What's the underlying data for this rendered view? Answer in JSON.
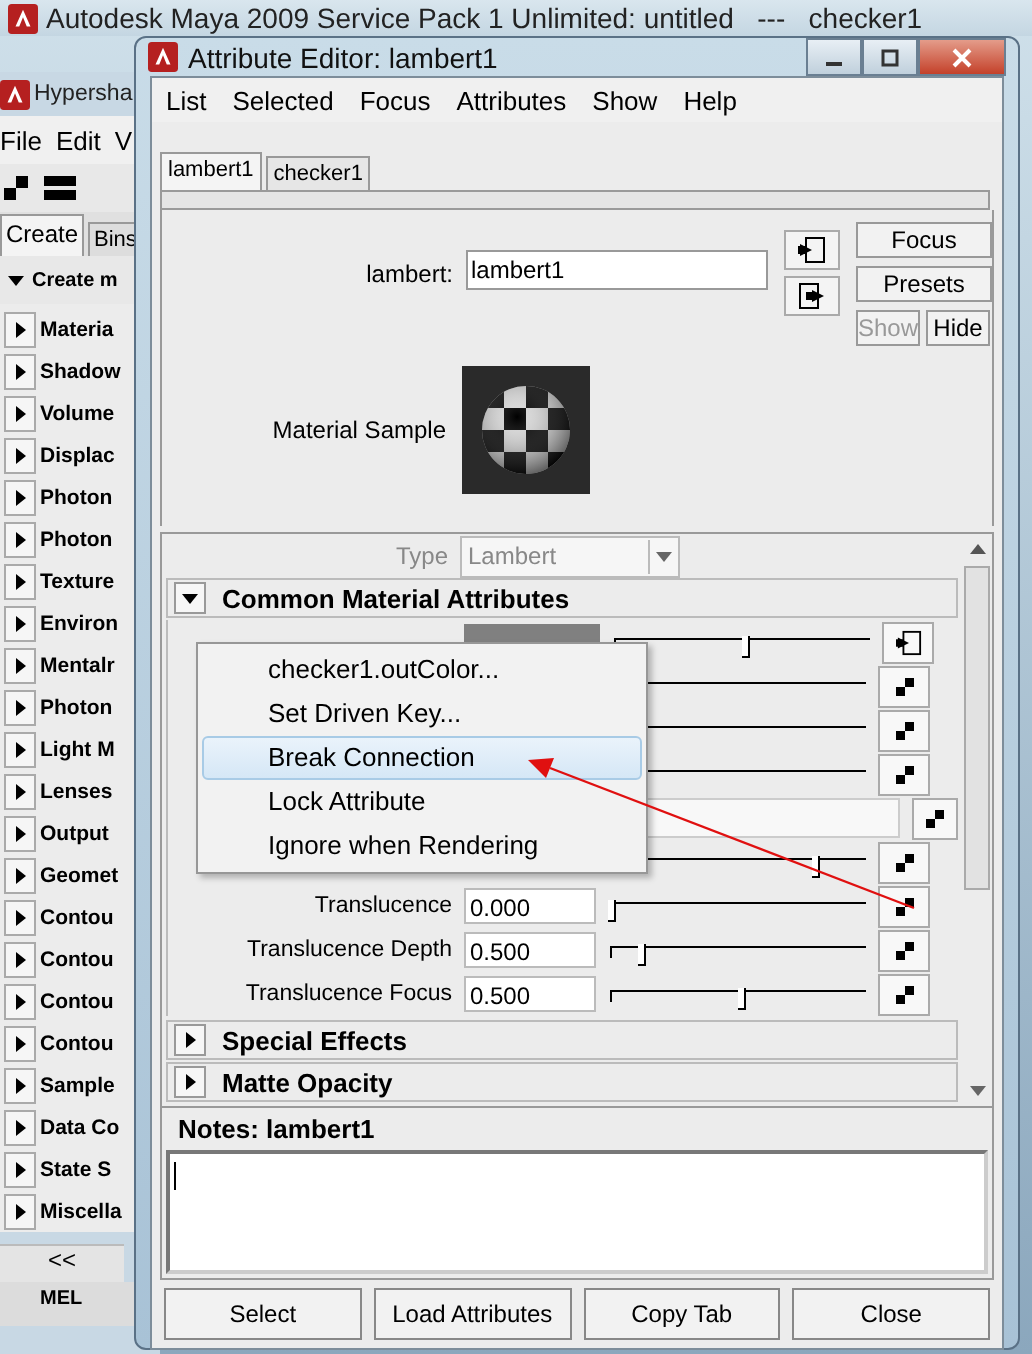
{
  "main_window": {
    "title": "Autodesk Maya 2009 Service Pack 1 Unlimited: untitled   ---   checker1"
  },
  "hypershade": {
    "title": "Hypersha",
    "menu": [
      "File",
      "Edit",
      "V"
    ],
    "tabs": [
      {
        "label": "Create",
        "selected": true
      },
      {
        "label": "Bins",
        "selected": false
      }
    ],
    "section": "Create m",
    "items": [
      "Materia",
      "Shadow",
      "Volume",
      "Displac",
      "Photon",
      "Photon",
      "Texture",
      "Environ",
      "Mentalr",
      "Photon",
      "Light M",
      "Lenses",
      "Output",
      "Geomet",
      "Contou",
      "Contou",
      "Contou",
      "Contou",
      "Sample",
      "Data Co",
      "State S",
      "Miscella"
    ],
    "collapse": "<<",
    "bottom_tab": "MEL"
  },
  "attribute_editor": {
    "title": "Attribute Editor: lambert1",
    "menu": [
      "List",
      "Selected",
      "Focus",
      "Attributes",
      "Show",
      "Help"
    ],
    "tabs": [
      {
        "label": "lambert1",
        "selected": true
      },
      {
        "label": "checker1",
        "selected": false
      }
    ],
    "name_label": "lambert:",
    "name_value": "lambert1",
    "buttons": [
      {
        "label": "Focus",
        "disabled": false
      },
      {
        "label": "Presets",
        "disabled": false
      },
      {
        "label": "Show",
        "disabled": true
      },
      {
        "label": "Hide",
        "disabled": false
      }
    ],
    "sample_label": "Material Sample",
    "type_label": "Type",
    "type_value": "Lambert",
    "sections": [
      {
        "title": "Common Material Attributes",
        "expanded": true,
        "rows": [
          {
            "kind": "color",
            "connected": true,
            "level": 0.51
          },
          {
            "kind": "slider",
            "connected": false
          },
          {
            "kind": "slider",
            "connected": false
          },
          {
            "kind": "slider",
            "connected": false
          },
          {
            "kind": "field",
            "connected": false
          },
          {
            "kind": "slider",
            "connected": false,
            "level": 0.8
          },
          {
            "kind": "slider",
            "connected": false,
            "label": "Translucence",
            "value": "0.000",
            "level": 0.0
          },
          {
            "kind": "slider",
            "connected": false,
            "label": "Translucence Depth",
            "value": "0.500",
            "level": 0.12
          },
          {
            "kind": "slider",
            "connected": false,
            "label": "Translucence Focus",
            "value": "0.500",
            "level": 0.51
          }
        ]
      },
      {
        "title": "Special Effects",
        "expanded": false
      },
      {
        "title": "Matte Opacity",
        "expanded": false
      }
    ],
    "notes_label": "Notes:  lambert1",
    "footer_buttons": [
      "Select",
      "Load Attributes",
      "Copy Tab",
      "Close"
    ]
  },
  "context_menu": {
    "items": [
      {
        "label": "checker1.outColor...",
        "selected": false
      },
      {
        "label": "Set Driven Key...",
        "selected": false
      },
      {
        "label": "Break Connection",
        "selected": true
      },
      {
        "label": "Lock Attribute",
        "selected": false
      },
      {
        "label": "Ignore when Rendering",
        "selected": false
      }
    ]
  }
}
